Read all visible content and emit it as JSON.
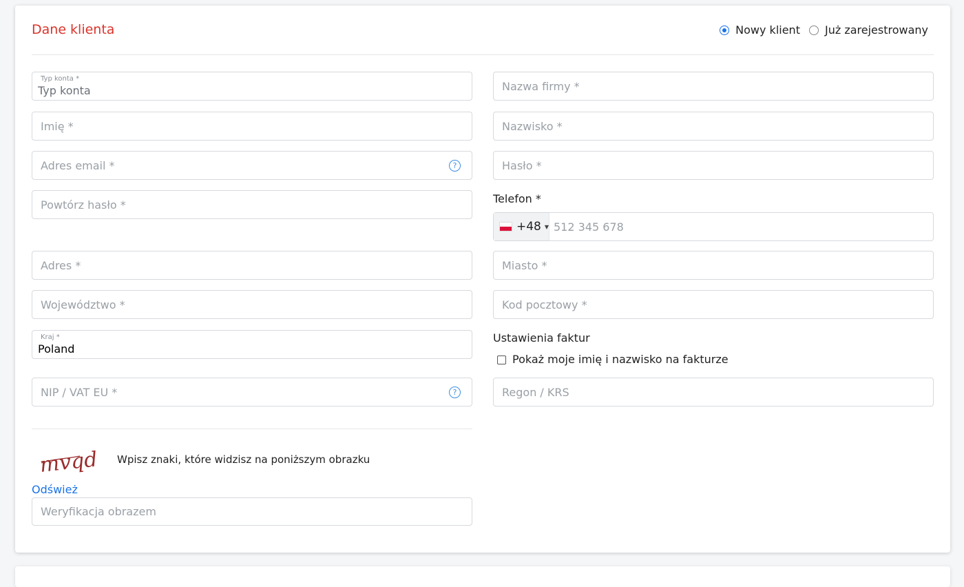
{
  "header": {
    "title": "Dane klienta"
  },
  "client_type": {
    "options": [
      {
        "label": "Nowy klient",
        "checked": true
      },
      {
        "label": "Już zarejestrowany",
        "checked": false
      }
    ]
  },
  "fields": {
    "account_type": {
      "label": "Typ konta *",
      "value": "Typ konta"
    },
    "company_name": {
      "placeholder": "Nazwa firmy *"
    },
    "first_name": {
      "placeholder": "Imię *"
    },
    "last_name": {
      "placeholder": "Nazwisko *"
    },
    "email": {
      "placeholder": "Adres email *"
    },
    "password": {
      "placeholder": "Hasło *"
    },
    "repeat_password": {
      "placeholder": "Powtórz hasło *"
    },
    "phone": {
      "label": "Telefon *",
      "prefix": "+48",
      "placeholder": "512 345 678"
    },
    "address": {
      "placeholder": "Adres *"
    },
    "city": {
      "placeholder": "Miasto *"
    },
    "province": {
      "placeholder": "Województwo *"
    },
    "postal_code": {
      "placeholder": "Kod pocztowy *"
    },
    "country": {
      "label": "Kraj *",
      "value": "Poland"
    },
    "nip": {
      "placeholder": "NIP / VAT EU *"
    },
    "regon": {
      "placeholder": "Regon / KRS"
    }
  },
  "invoice": {
    "heading": "Ustawienia faktur",
    "checkbox_label": "Pokaż moje imię i nazwisko na fakturze"
  },
  "captcha": {
    "text": "mvqd",
    "instruction": "Wpisz znaki, które widzisz na poniższym obrazku",
    "refresh": "Odśwież",
    "placeholder": "Weryfikacja obrazem"
  },
  "help_icon": "?",
  "colors": {
    "title": "#d9342b",
    "accent": "#1a73e8",
    "captcha": "#9b2c2c"
  }
}
